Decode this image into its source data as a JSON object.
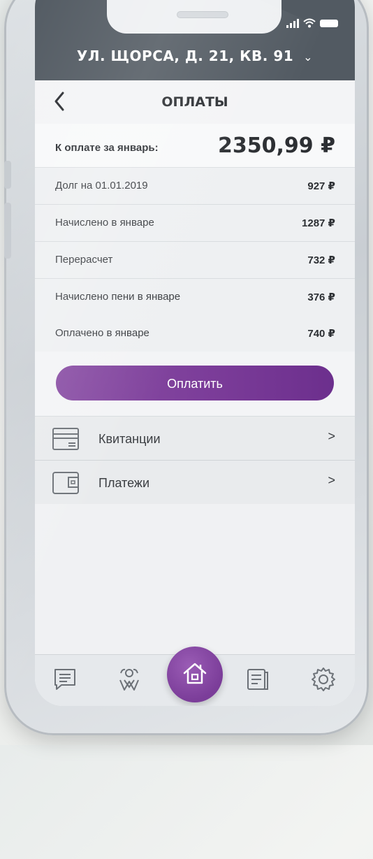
{
  "header": {
    "address": "УЛ. ЩОРСА, Д. 21, КВ. 91",
    "title": "ОПЛАТЫ"
  },
  "summary": {
    "label": "К оплате за январь:",
    "value": "2350,99 ₽"
  },
  "rows": [
    {
      "label": "Долг на 01.01.2019",
      "value": "927 ₽"
    },
    {
      "label": "Начислено в январе",
      "value": "1287 ₽"
    },
    {
      "label": "Перерасчет",
      "value": "732 ₽"
    },
    {
      "label": "Начислено пени в январе",
      "value": "376 ₽"
    },
    {
      "label": "Оплачено в январе",
      "value": "740 ₽"
    }
  ],
  "pay_button": "Оплатить",
  "menu": [
    {
      "label": "Квитанции",
      "icon": "receipt-icon"
    },
    {
      "label": "Платежи",
      "icon": "wallet-icon"
    }
  ],
  "tabbar": {
    "tabs": [
      "chat-icon",
      "community-icon",
      "home-icon",
      "documents-icon",
      "settings-icon"
    ],
    "active": "home-icon"
  },
  "colors": {
    "accent": "#7b3d99",
    "header_bg": "#525a62",
    "text": "#2c2f33"
  }
}
